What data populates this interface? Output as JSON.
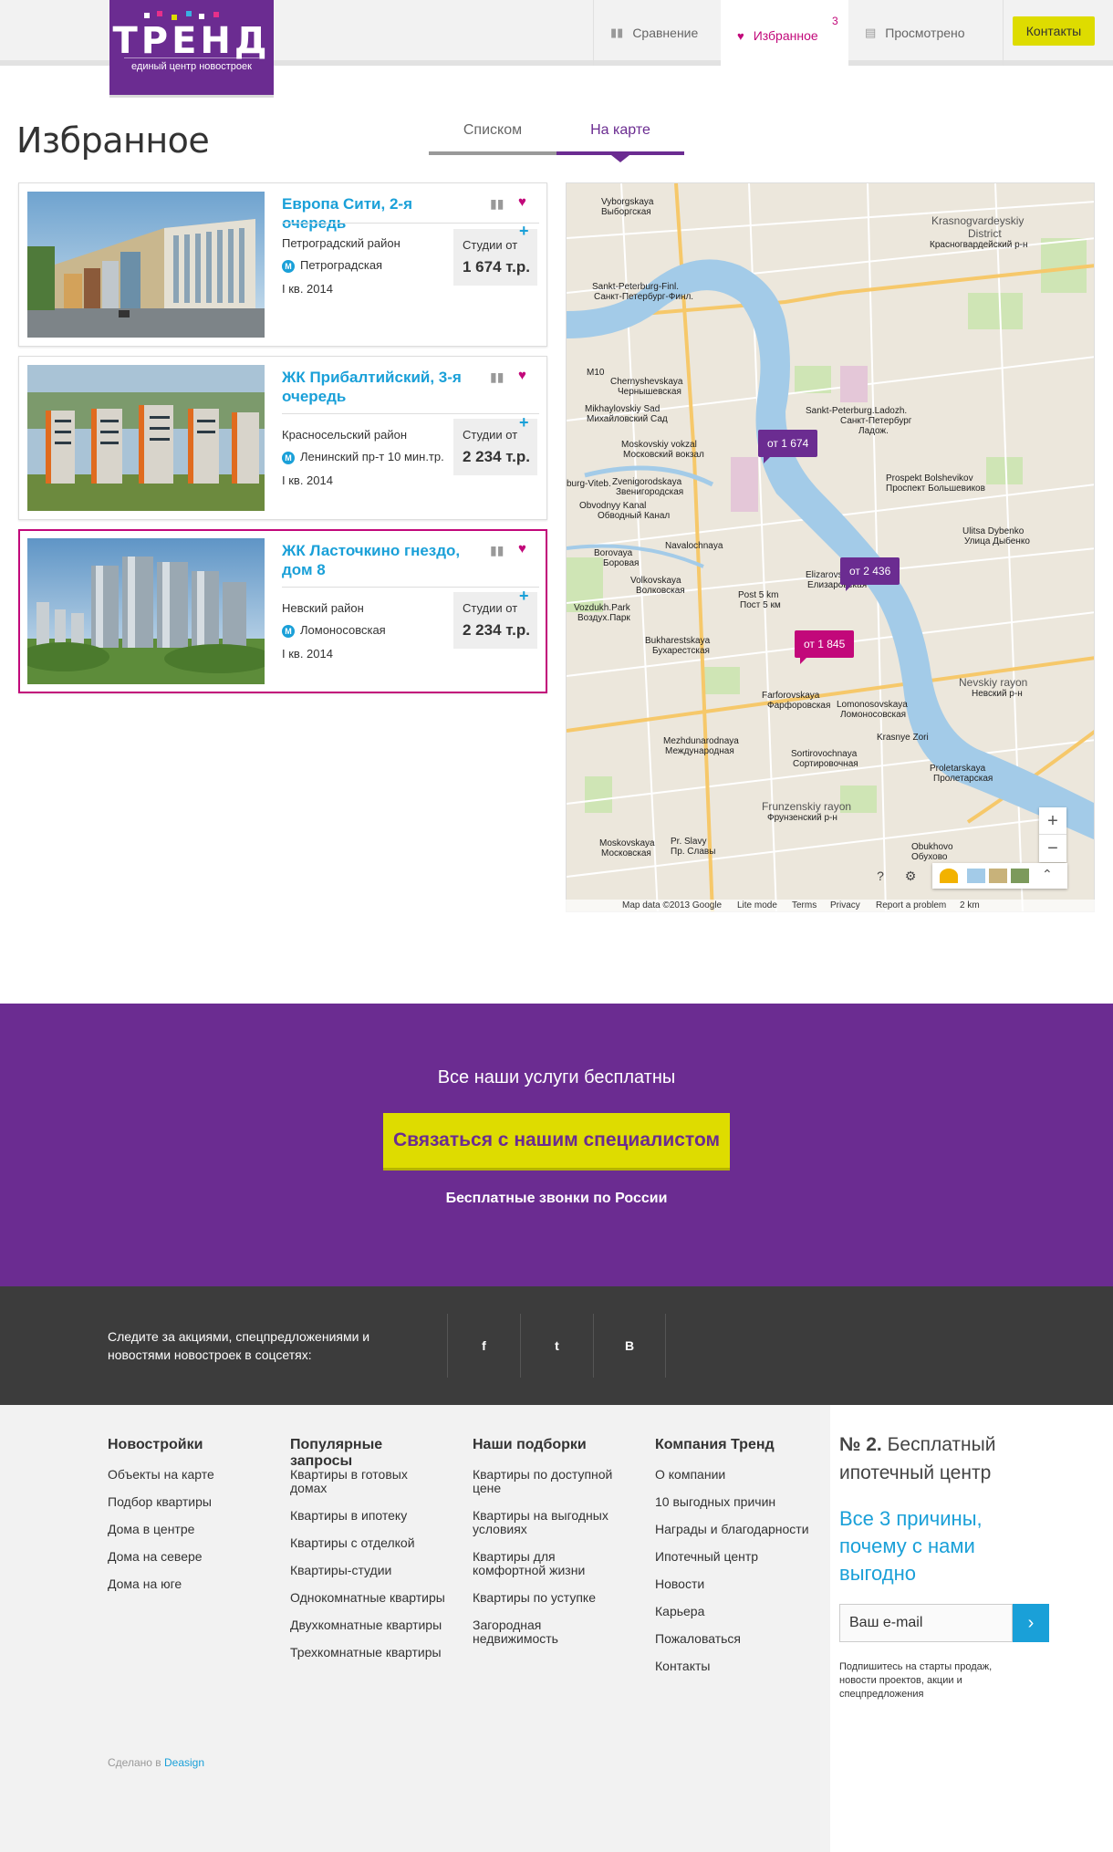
{
  "header": {
    "logo_name": "ТРЕНД",
    "logo_sub": "единый центр новостроек",
    "nav": {
      "compare": "Сравнение",
      "favorites": "Избранное",
      "favorites_count": "3",
      "viewed": "Просмотрено"
    },
    "contacts": "Контакты"
  },
  "page": {
    "title": "Избранное",
    "tabs": [
      "Списком",
      "На карте"
    ],
    "active_tab": "На карте"
  },
  "cards": [
    {
      "title": "Европа Сити, 2-я очередь",
      "district": "Петроградский район",
      "metro": "Петроградская",
      "date": "I кв. 2014",
      "price_label": "Студии от",
      "price": "1 674 т.р."
    },
    {
      "title": "ЖК Прибалтийский, 3-я очередь",
      "district": "Красносельский район",
      "metro": "Ленинский пр-т 10 мин.тр.",
      "date": "I кв. 2014",
      "price_label": "Студии от",
      "price": "2 234 т.р."
    },
    {
      "title": "ЖК Ласточкино гнездо, дом 8",
      "district": "Невский район",
      "metro": "Ломоносовская",
      "date": "I кв. 2014",
      "price_label": "Студии от",
      "price": "2 234 т.р."
    }
  ],
  "map": {
    "pins": [
      "от 1 674",
      "от 2 436",
      "от 1 845"
    ],
    "labels": {
      "vyborgskaya": "Vyborgskaya",
      "vyborgskaya_ru": "Выборгская",
      "krasnogvard": "Krasnogvardeyskiy",
      "krasnogvard2": "District",
      "krasnogvard_ru": "Красногвардейский р-н",
      "spb_finl": "Sankt-Peterburg-Finl.",
      "spb_finl_ru": "Санкт-Петербург-Финл.",
      "chern": "Chernyshevskaya",
      "chern_ru": "Чернышевская",
      "mikh": "Mikhaylovskiy Sad",
      "mikh_ru": "Михайловский Сад",
      "ladoz": "Sankt-Peterburg.Ladozh.",
      "ladoz_ru": "Санкт-Петербург",
      "ladoz_ru2": "Ладож.",
      "mosk_vokzal": "Moskovskiy vokzal",
      "mosk_vokzal_ru": "Московский вокзал",
      "bolsh": "Prospekt Bolshevikov",
      "bolsh_ru": "Проспект Большевиков",
      "zven": "Zvenigorodskaya",
      "zven_ru": "Звенигородская",
      "vitebsk": "burg-Viteb.",
      "obv": "Obvodnyy Kanal",
      "obv_ru": "Обводный Канал",
      "dybenko": "Ulitsa Dybenko",
      "dybenko_ru": "Улица Дыбенко",
      "boro": "Borovaya",
      "boro_ru": "Боровая",
      "naval": "Navalochnaya",
      "voll": "Volkovskaya",
      "voll_ru": "Волковская",
      "eliz": "Elizarovskaya",
      "eliz_ru": "Елизаровская",
      "vozd": "Vozdukh.Park",
      "vozd_ru": "Воздух.Парк",
      "post5": "Post 5 km",
      "post5_ru": "Пост 5 км",
      "nevskiy": "Nevskiy rayon",
      "nevskiy_ru": "Невский р-н",
      "buh": "Bukharestskaya",
      "buh_ru": "Бухарестская",
      "farf": "Farforovskaya",
      "farf_ru": "Фарфоровская",
      "lomo": "Lomonosovskaya",
      "lomo_ru": "Ломоносовская",
      "kras_zor": "Krasnye Zori",
      "mezh": "Mezhdunarodnaya",
      "mezh_ru": "Международная",
      "sort": "Sortirovochnaya",
      "sort_ru": "Сортировочная",
      "prol": "Proletarskaya",
      "prol_ru": "Пролетарская",
      "frunz": "Frunzenskiy rayon",
      "frunz_ru": "Фрунзенский р-н",
      "moskov": "Moskovskaya",
      "moskov_ru": "Московская",
      "slavy": "Pr. Slavy",
      "slavy_ru": "Пр. Славы",
      "obukh": "Obukhovo",
      "obukh_ru": "Обухово"
    },
    "footer": {
      "data": "Map data ©2013 Google",
      "lite": "Lite mode",
      "terms": "Terms",
      "privacy": "Privacy",
      "report": "Report a problem",
      "scale": "2 km"
    }
  },
  "promo": {
    "heading": "Все наши услуги бесплатны",
    "button": "Связаться с нашим специалистом",
    "sub": "Бесплатные звонки по России"
  },
  "social": {
    "text": "Следите за акциями, спецпредложениями и новостями новостроек в соцсетях:",
    "buttons": [
      "f",
      "t",
      "B"
    ]
  },
  "footer": {
    "cols": [
      {
        "title": "Новостройки",
        "links": [
          "Объекты на карте",
          "Подбор квартиры",
          "Дома в центре",
          "Дома на севере",
          "Дома на юге"
        ]
      },
      {
        "title": "Популярные запросы",
        "links": [
          "Квартиры в готовых домах",
          "Квартиры в ипотеку",
          "Квартиры с отделкой",
          "Квартиры-студии",
          "Однокомнатные квартиры",
          "Двухкомнатные квартиры",
          "Трехкомнатные квартиры"
        ]
      },
      {
        "title": "Наши подборки",
        "links": [
          "Квартиры по доступной цене",
          "Квартиры на выгодных условиях",
          "Квартиры для комфортной жизни",
          "Квартиры по уступке",
          "Загородная недвижимость"
        ]
      },
      {
        "title": "Компания Тренд",
        "links": [
          "О компании",
          "10 выгодных причин",
          "Награды и благодарности",
          "Ипотечный центр",
          "Новости",
          "Карьера",
          "Пожаловаться",
          "Контакты"
        ]
      }
    ],
    "made_prefix": "Сделано в",
    "made_link": "Deasign",
    "side": {
      "number": "№ 2.",
      "heading": "Бесплатный ипотечный центр",
      "reasons": "Все 3 причины, почему с нами выгодно",
      "email_placeholder": "Ваш e-mail",
      "note": "Подпишитесь на старты продаж, новости проектов, акции и спецпредложения"
    }
  },
  "colors": {
    "brand_purple": "#6b2c91",
    "accent_magenta": "#c2087a",
    "link_blue": "#1aa0d8",
    "accent_yellow": "#dedc00"
  },
  "icons": {
    "compare": "bar-chart-icon",
    "favorites": "heart-icon",
    "viewed": "document-icon",
    "metro": "metro-icon",
    "add": "plus-icon",
    "submit": "chevron-right-icon"
  }
}
